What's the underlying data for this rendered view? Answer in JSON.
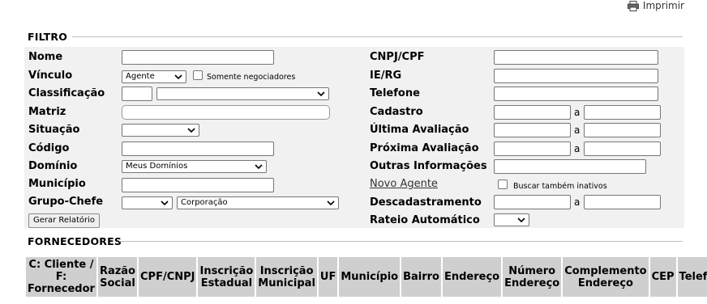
{
  "header": {
    "print_label": "Imprimir"
  },
  "filtro": {
    "title": "FILTRO",
    "nome_label": "Nome",
    "vinculo_label": "Vínculo",
    "vinculo_value": "Agente",
    "somente_negociadores": "Somente negociadores",
    "classificacao_label": "Classificação",
    "matriz_label": "Matriz",
    "situacao_label": "Situação",
    "codigo_label": "Código",
    "dominio_label": "Domínio",
    "dominio_value": "Meus Domínios",
    "municipio_label": "Município",
    "grupo_chefe_label": "Grupo-Chefe",
    "grupo_chefe_value2": "Corporação",
    "gerar_relatorio": "Gerar Relatório",
    "cnpj_cpf_label": "CNPJ/CPF",
    "ie_rg_label": "IE/RG",
    "telefone_label": "Telefone",
    "cadastro_label": "Cadastro",
    "ultima_avaliacao_label": "Última Avaliação",
    "proxima_avaliacao_label": "Próxima Avaliação",
    "outras_informacoes_label": "Outras Informações",
    "novo_agente": "Novo Agente",
    "buscar_inativos": "Buscar também inativos",
    "descadastramento_label": "Descadastramento",
    "rateio_label": "Rateio Automático",
    "range_sep": "a"
  },
  "fornecedores": {
    "title": "FORNECEDORES",
    "columns": [
      "C: Cliente / F: Fornecedor",
      "Razão Social",
      "CPF/CNPJ",
      "Inscrição Estadual",
      "Inscrição Municipal",
      "UF",
      "Município",
      "Bairro",
      "Endereço",
      "Número Endereço",
      "Complemento Endereço",
      "CEP",
      "Telefone"
    ]
  }
}
